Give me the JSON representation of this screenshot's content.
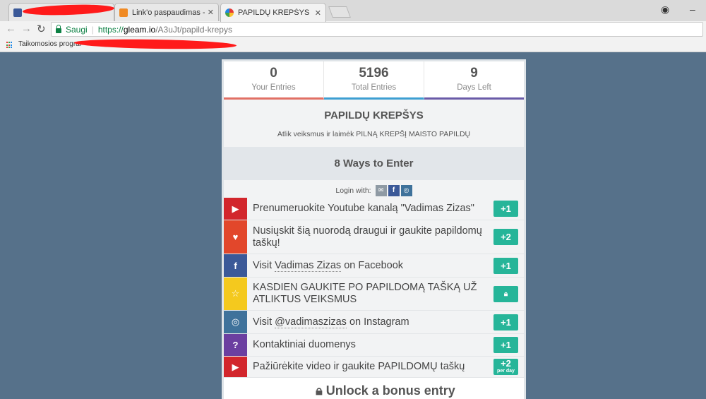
{
  "browser": {
    "tabs": [
      {
        "title": "",
        "favicon": "facebook-favicon"
      },
      {
        "title": "Link'o paspaudimas - to",
        "favicon": "orange-favicon"
      },
      {
        "title": "PAPILDŲ KREPŠYS",
        "favicon": "gleam-favicon"
      }
    ],
    "close_glyph": "✕",
    "url": {
      "secure_label": "Saugi",
      "scheme": "https://",
      "host": "gleam.io",
      "path": "/A3uJt/papild-krepys"
    },
    "bookmarks": {
      "apps_label": "Taikomosios prograr"
    }
  },
  "stats": [
    {
      "value": "0",
      "label": "Your Entries"
    },
    {
      "value": "5196",
      "label": "Total Entries"
    },
    {
      "value": "9",
      "label": "Days Left"
    }
  ],
  "campaign": {
    "title": "PAPILDŲ KREPŠYS",
    "description": "Atlik veiksmus ir laimėk PILNĄ KREPŠĮ MAISTO PAPILDŲ",
    "ways_label": "8 Ways to Enter",
    "login_label": "Login with:"
  },
  "entries": [
    {
      "icon": "youtube-icon",
      "text": "Prenumeruokite Youtube kanalą \"Vadimas Zizas\"",
      "badge": "+1"
    },
    {
      "icon": "heart-icon",
      "text": "Nusiųskit šią nuorodą draugui ir gaukite papildomų taškų!",
      "badge": "+2"
    },
    {
      "icon": "facebook-icon",
      "text_pre": "Visit ",
      "text_link": "Vadimas Zizas",
      "text_post": " on Facebook",
      "badge": "+1"
    },
    {
      "icon": "star-icon",
      "text": "KASDIEN GAUKITE PO PAPILDOMĄ TAŠKĄ UŽ ATLIKTUS VEIKSMUS",
      "badge": "lock"
    },
    {
      "icon": "instagram-icon",
      "text_pre": "Visit ",
      "text_link": "@vadimaszizas",
      "text_post": " on Instagram",
      "badge": "+1"
    },
    {
      "icon": "question-icon",
      "text": "Kontaktiniai duomenys",
      "badge": "+1"
    },
    {
      "icon": "youtube-icon",
      "text": "Pažiūrėkite video ir gaukite PAPILDOMŲ taškų",
      "badge": "+2",
      "badge_sub": "per day"
    }
  ],
  "bonus": {
    "label": "Unlock a bonus entry"
  },
  "colors": {
    "accent_green": "#26b599",
    "youtube": "#d2262c",
    "facebook": "#3b5998",
    "instagram": "#3f729b",
    "star": "#f4c91e",
    "question": "#6b3fa0",
    "heart": "#e2472b",
    "background": "#56718a"
  }
}
